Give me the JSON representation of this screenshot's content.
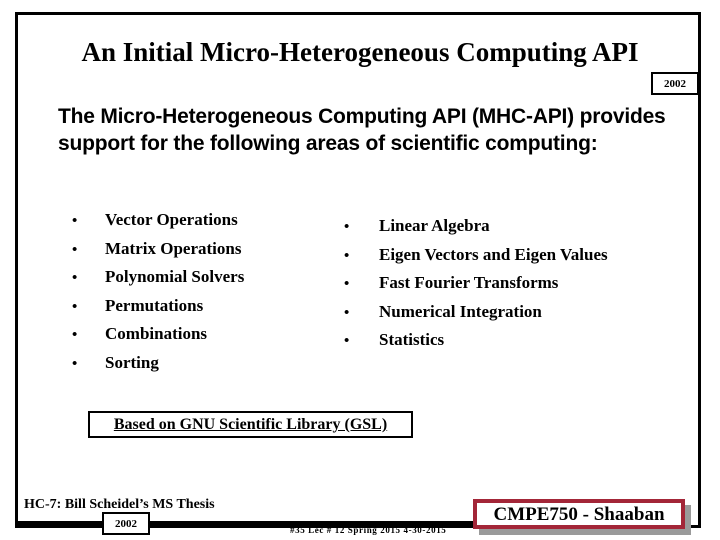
{
  "slide": {
    "title": "An Initial Micro-Heterogeneous Computing API",
    "title_year_stamp": "2002",
    "intro_paragraph": "The Micro-Heterogeneous Computing API (MHC-API) provides support for the following areas of scientific computing:",
    "bullet_glyph": "•",
    "left_column": [
      {
        "label": "Vector Operations"
      },
      {
        "label": "Matrix Operations"
      },
      {
        "label": "Polynomial Solvers"
      },
      {
        "label": "Permutations"
      },
      {
        "label": "Combinations"
      },
      {
        "label": "Sorting"
      }
    ],
    "right_column": [
      {
        "label": "Linear Algebra"
      },
      {
        "label": "Eigen Vectors and Eigen Values"
      },
      {
        "label": "Fast Fourier Transforms"
      },
      {
        "label": "Numerical Integration"
      },
      {
        "label": "Statistics"
      }
    ],
    "gsl_note": "Based on GNU Scientific Library (GSL)",
    "footer": {
      "thesis_label": "HC-7: Bill Scheidel’s MS Thesis",
      "year_stamp": "2002",
      "meta": "#35  Lec # 12   Spring 2015  4-30-2015",
      "course_banner": "CMPE750 - Shaaban"
    }
  },
  "colors": {
    "frame": "#000000",
    "text": "#000000",
    "banner_border": "#a32638",
    "banner_shadow": "#9a9a9a",
    "background": "#ffffff"
  }
}
